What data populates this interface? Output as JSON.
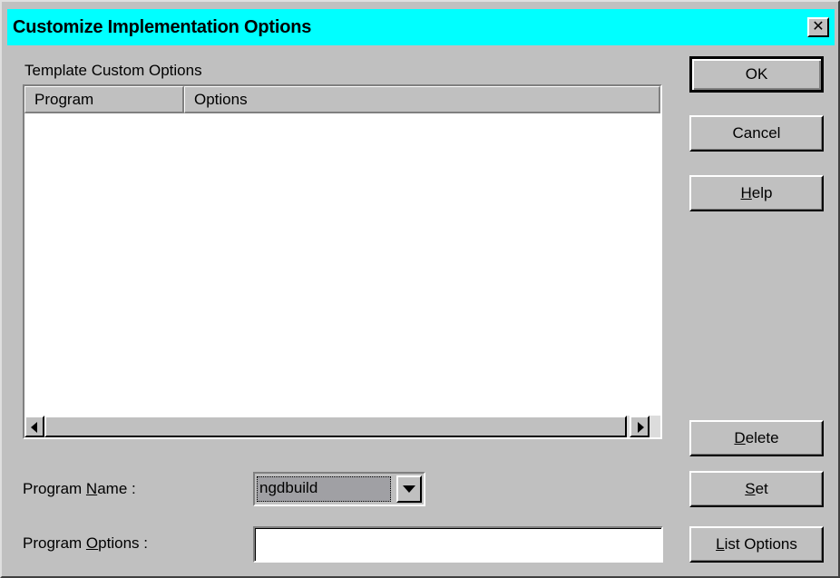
{
  "window": {
    "title": "Customize Implementation Options",
    "close_glyph": "✕"
  },
  "list": {
    "group_label": "Template Custom Options",
    "columns": [
      "Program",
      "Options"
    ],
    "rows": []
  },
  "form": {
    "program_name_label_pre": "Program ",
    "program_name_label_mn": "N",
    "program_name_label_post": "ame :",
    "program_name_value": "ngdbuild",
    "program_options_label_pre": "Program ",
    "program_options_label_mn": "O",
    "program_options_label_post": "ptions :",
    "program_options_value": ""
  },
  "buttons": {
    "ok": "OK",
    "cancel": "Cancel",
    "help_mn": "H",
    "help_rest": "elp",
    "delete_mn": "D",
    "delete_rest": "elete",
    "set_mn": "S",
    "set_rest": "et",
    "list_options_mn": "L",
    "list_options_rest": "ist Options"
  },
  "colors": {
    "titlebar": "#00ffff",
    "face": "#c0c0c0",
    "combo_selection": "#a0a0a4"
  }
}
